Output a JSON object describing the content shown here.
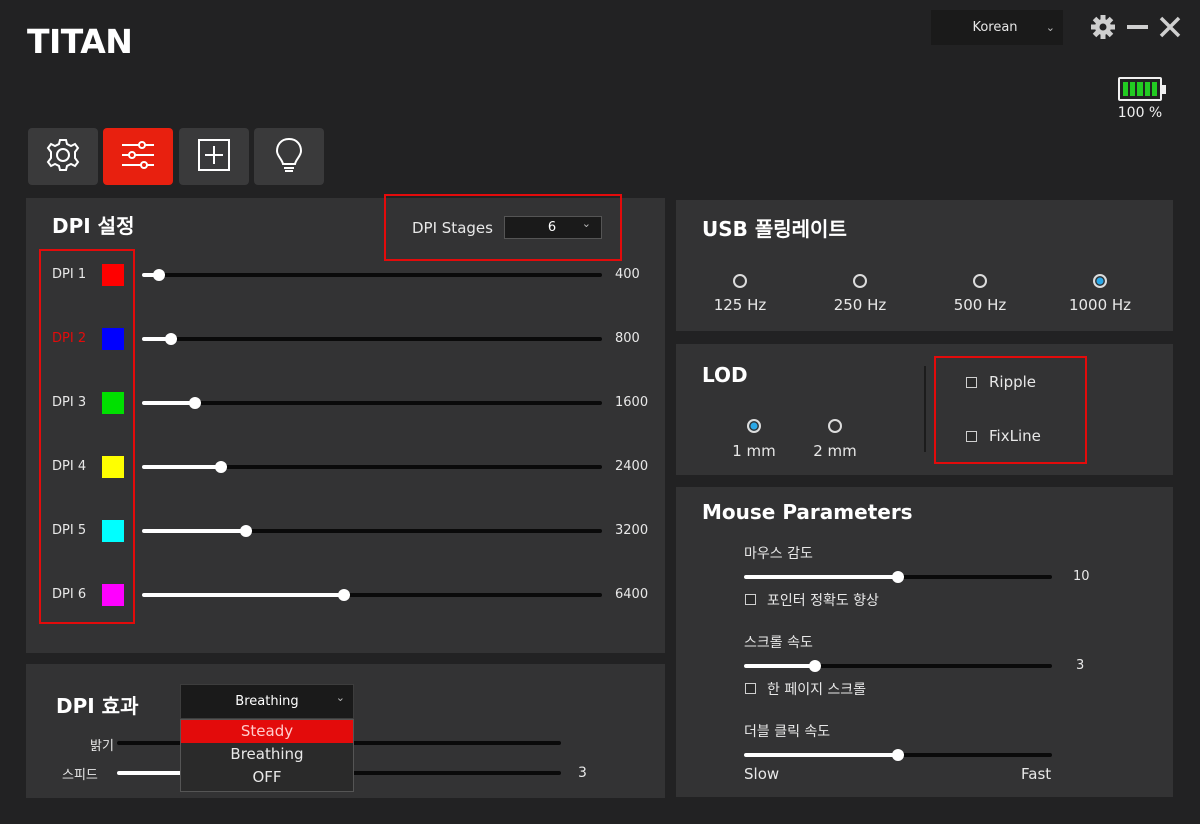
{
  "app": {
    "logo": "TITAN"
  },
  "header": {
    "language": "Korean",
    "battery": "100 %",
    "colors": {
      "battery_fill": "#22cc22",
      "accent": "#e8200f",
      "highlight": "#e30b0b"
    }
  },
  "tabs": [
    {
      "icon": "gear-icon",
      "active": false
    },
    {
      "icon": "sliders-icon",
      "active": true
    },
    {
      "icon": "macro-plus-icon",
      "active": false
    },
    {
      "icon": "bulb-icon",
      "active": false
    }
  ],
  "dpi": {
    "title": "DPI 설정",
    "stages_label": "DPI Stages",
    "stages_value": "6",
    "rows": [
      {
        "label": "DPI 1",
        "color": "#ff0000",
        "value": "400",
        "level": 0.036,
        "active": false
      },
      {
        "label": "DPI 2",
        "color": "#0000ff",
        "value": "800",
        "level": 0.063,
        "active": true
      },
      {
        "label": "DPI 3",
        "color": "#00e000",
        "value": "1600",
        "level": 0.116,
        "active": false
      },
      {
        "label": "DPI 4",
        "color": "#ffff00",
        "value": "2400",
        "level": 0.171,
        "active": false
      },
      {
        "label": "DPI 5",
        "color": "#00ffff",
        "value": "3200",
        "level": 0.225,
        "active": false
      },
      {
        "label": "DPI 6",
        "color": "#ff00ff",
        "value": "6400",
        "level": 0.44,
        "active": false
      }
    ]
  },
  "effect": {
    "title": "DPI 효과",
    "selected": "Breathing",
    "options": [
      "Steady",
      "Breathing",
      "OFF"
    ],
    "highlighted_option": "Steady",
    "brightness_label": "밝기",
    "brightness_level": 0.0,
    "speed_label": "스피드",
    "speed_value": "3",
    "speed_level": 0.2
  },
  "usb": {
    "title": "USB 폴링레이트",
    "options": [
      "125 Hz",
      "250 Hz",
      "500 Hz",
      "1000 Hz"
    ],
    "selected": "1000 Hz"
  },
  "lod": {
    "title": "LOD",
    "options": [
      "1 mm",
      "2 mm"
    ],
    "selected": "1 mm",
    "checks": [
      "Ripple",
      "FixLine"
    ]
  },
  "mouse": {
    "title": "Mouse Parameters",
    "sensitivity_label": "마우스 감도",
    "sensitivity_value": "10",
    "sensitivity_level": 0.5,
    "precision_label": "포인터 정확도 향상",
    "scroll_label": "스크롤 속도",
    "scroll_value": "3",
    "scroll_level": 0.23,
    "page_scroll_label": "한 페이지 스크롤",
    "dblclick_label": "더블 클릭 속도",
    "dblclick_level": 0.5,
    "slow_label": "Slow",
    "fast_label": "Fast"
  }
}
